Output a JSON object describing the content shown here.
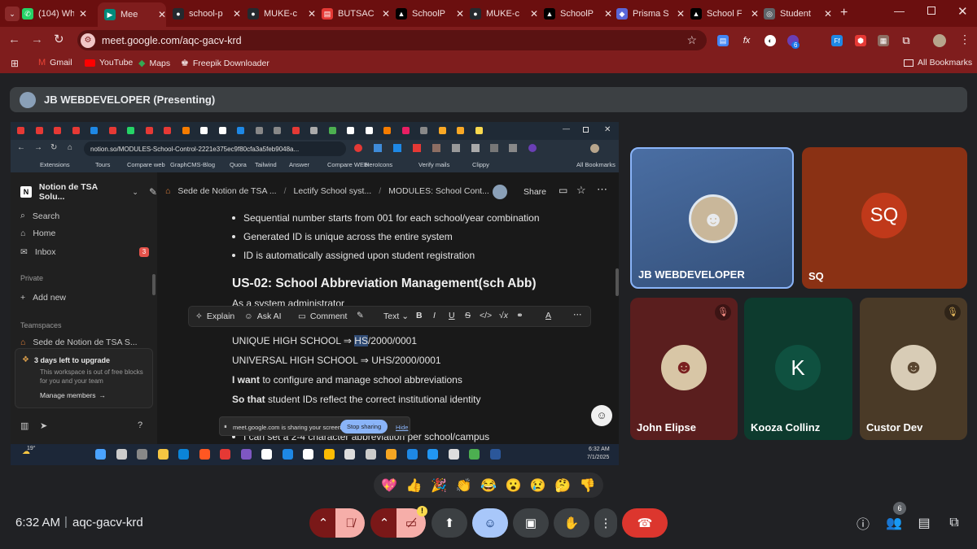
{
  "browser": {
    "tabs": [
      {
        "label": "(104) Wh",
        "icon": "whatsapp-icon",
        "color": "#25d366"
      },
      {
        "label": "Mee",
        "icon": "meet-icon",
        "color": "#00897b",
        "active": true
      },
      {
        "label": "school-p",
        "icon": "github-icon",
        "color": "#24292e"
      },
      {
        "label": "MUKE-c",
        "icon": "github-icon",
        "color": "#24292e"
      },
      {
        "label": "BUTSAC",
        "icon": "doc-icon",
        "color": "#e53935"
      },
      {
        "label": "SchoolP",
        "icon": "vercel-icon",
        "color": "#000000"
      },
      {
        "label": "MUKE-c",
        "icon": "github-icon",
        "color": "#24292e"
      },
      {
        "label": "SchoolP",
        "icon": "vercel-icon",
        "color": "#000000"
      },
      {
        "label": "Prisma S",
        "icon": "prisma-icon",
        "color": "#5a67d8"
      },
      {
        "label": "School F",
        "icon": "vercel-icon",
        "color": "#000000"
      },
      {
        "label": "Student",
        "icon": "globe-icon",
        "color": "#5f6368"
      }
    ],
    "url": "meet.google.com/aqc-gacv-krd",
    "bookmarks": [
      {
        "label": "Gmail",
        "icon": "gmail-icon"
      },
      {
        "label": "YouTube",
        "icon": "youtube-icon"
      },
      {
        "label": "Maps",
        "icon": "maps-icon"
      },
      {
        "label": "Freepik Downloader",
        "icon": "freepik-icon"
      }
    ],
    "all_bookmarks": "All Bookmarks",
    "ext_badge": "6"
  },
  "meet": {
    "presenter_label": "JB WEBDEVELOPER (Presenting)",
    "time": "6:32 AM",
    "separator": "|",
    "meeting_code": "aqc-gacv-krd",
    "people_count": "6",
    "reactions": [
      "💖",
      "👍",
      "🎉",
      "👏",
      "😂",
      "😮",
      "😢",
      "🤔",
      "👎"
    ],
    "participants": [
      {
        "name": "JB WEBDEVELOPER",
        "type": "photo"
      },
      {
        "name": "SQ",
        "initials": "SQ",
        "type": "initials"
      },
      {
        "name": "John Elipse",
        "type": "photo",
        "muted": true
      },
      {
        "name": "Kooza Collinz",
        "initials": "K",
        "type": "initials"
      },
      {
        "name": "Custor Dev",
        "type": "photo",
        "muted": true
      }
    ],
    "alert_badge": "!"
  },
  "shared": {
    "url": "notion.so/MODULES-School-Control-2221e375ec9f80cfa3a5feb9048a...",
    "bookmarks": [
      "Extensions",
      "Tours",
      "Compare web",
      "GraphCMS-Blog",
      "Quora",
      "Tailwind",
      "Answer",
      "Compare WEB",
      "HeroIcons",
      "Verify mails",
      "Clippy"
    ],
    "all_bookmarks": "All Bookmarks",
    "workspace": "Notion de TSA Solu...",
    "nav": {
      "search": "Search",
      "home": "Home",
      "inbox": "Inbox",
      "inbox_badge": "3"
    },
    "private_label": "Private",
    "add_new": "Add new",
    "teamspaces_label": "Teamspaces",
    "teamspace_item": "Sede de Notion de TSA S...",
    "upgrade": {
      "title": "3 days left to upgrade",
      "body": "This workspace is out of free blocks for you and your team",
      "link": "Manage members"
    },
    "breadcrumb": [
      "Sede de Notion de TSA ...",
      "Lectify School syst...",
      "MODULES: School Cont..."
    ],
    "breadcrumb_sep": "/",
    "share": "Share",
    "bullets": [
      "Sequential number starts from 001 for each school/year combination",
      "Generated ID is unique across the entire system",
      "ID is automatically assigned upon student registration"
    ],
    "heading": "US-02: School Abbreviation Management(sch Abb)",
    "as_a": "As a system administrator",
    "toolbar": {
      "explain": "Explain",
      "ask_ai": "Ask AI",
      "comment": "Comment",
      "text": "Text"
    },
    "line1_pre": "UNIQUE HIGH SCHOOL ⇒ ",
    "line1_sel": "HS",
    "line1_post": "/2000/0001",
    "line2": "UNIVERSAL HIGH SCHOOL ⇒ UHS/2000/0001",
    "i_want_bold": "I want",
    "i_want_rest": " to configure and manage school abbreviations",
    "so_that_bold": "So that",
    "so_that_rest": " student IDs reflect the correct institutional identity",
    "last_bullet": "I can set a 2-4 character abbreviation per school/campus",
    "sharing_notice": "meet.google.com is sharing your screen.",
    "stop_sharing": "Stop sharing",
    "hide": "Hide",
    "taskbar_temp": "19°",
    "taskbar_time": "6:32 AM",
    "taskbar_date": "7/1/2025"
  }
}
